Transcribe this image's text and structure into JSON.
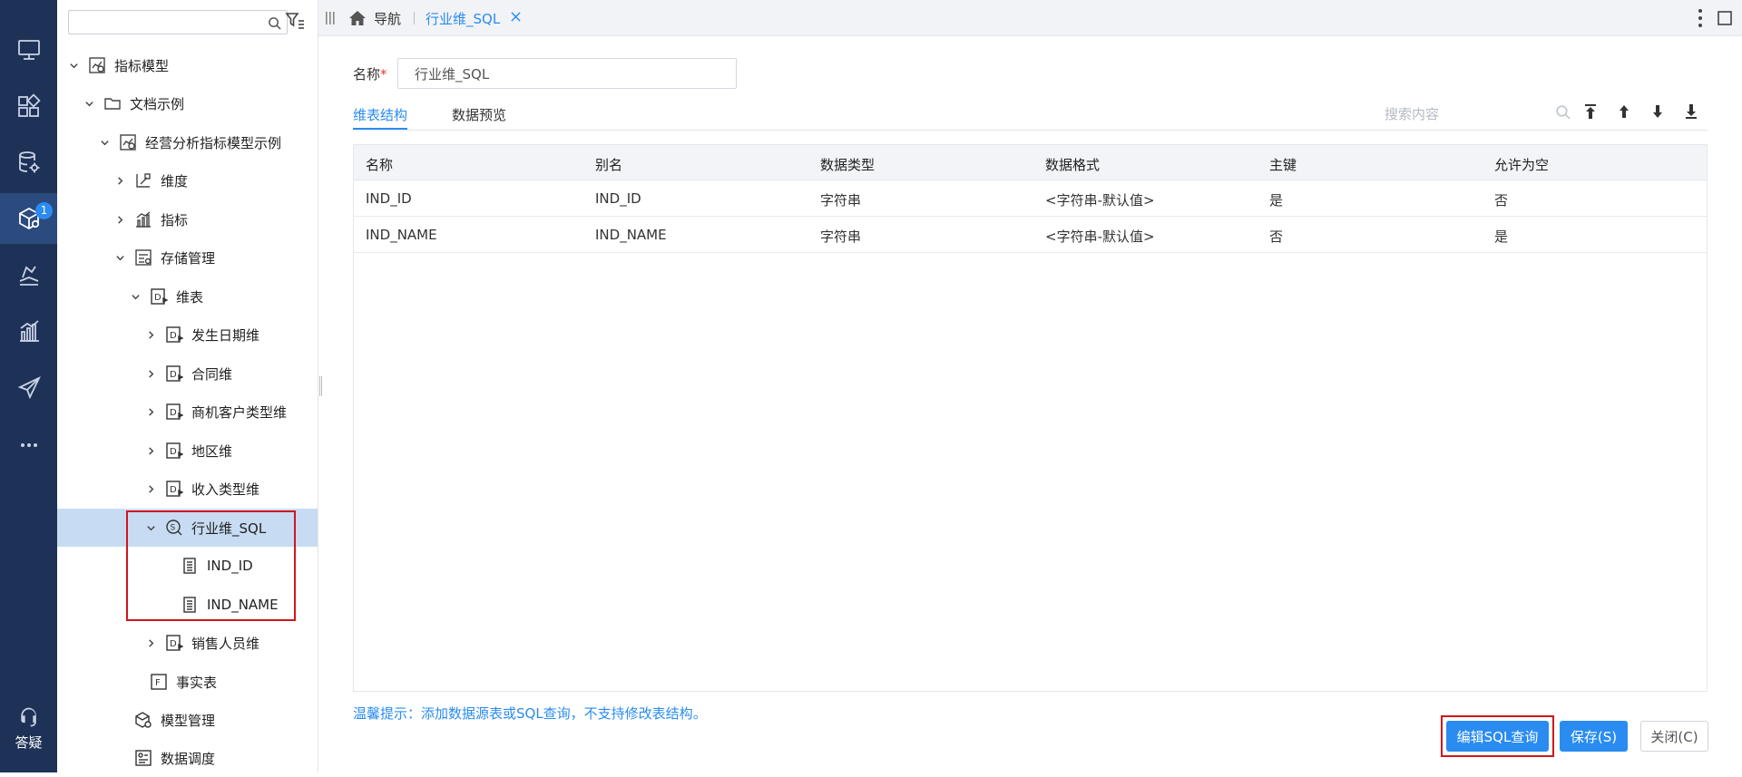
{
  "rail": {
    "badge": "1",
    "help_label": "答疑",
    "items": [
      {
        "icon": "monitor-icon"
      },
      {
        "icon": "apps-icon"
      },
      {
        "icon": "database-settings-icon"
      },
      {
        "icon": "cube-icon"
      },
      {
        "icon": "layers-icon"
      },
      {
        "icon": "bar-chart-icon"
      },
      {
        "icon": "send-icon"
      },
      {
        "icon": "more-horizontal-icon"
      }
    ]
  },
  "tree": {
    "search_placeholder": "",
    "nodes": [
      {
        "label": "指标模型",
        "icon": "metric-model-icon",
        "expanded": true
      },
      {
        "label": "文档示例",
        "icon": "folder-icon",
        "expanded": true
      },
      {
        "label": "经营分析指标模型示例",
        "icon": "metric-model-icon",
        "expanded": true
      },
      {
        "label": "维度",
        "icon": "dimension-icon",
        "expanded": false
      },
      {
        "label": "指标",
        "icon": "metric-icon",
        "expanded": false
      },
      {
        "label": "存储管理",
        "icon": "storage-icon",
        "expanded": true
      },
      {
        "label": "维表",
        "icon": "dim-table-icon",
        "expanded": true
      },
      {
        "label": "发生日期维",
        "icon": "dim-table-icon",
        "expanded": false
      },
      {
        "label": "合同维",
        "icon": "dim-table-icon",
        "expanded": false
      },
      {
        "label": "商机客户类型维",
        "icon": "dim-table-icon",
        "expanded": false
      },
      {
        "label": "地区维",
        "icon": "dim-table-icon",
        "expanded": false
      },
      {
        "label": "收入类型维",
        "icon": "dim-table-icon",
        "expanded": false
      },
      {
        "label": "行业维_SQL",
        "icon": "sql-query-icon",
        "expanded": true
      },
      {
        "label": "IND_ID",
        "icon": "field-icon"
      },
      {
        "label": "IND_NAME",
        "icon": "field-icon"
      },
      {
        "label": "销售人员维",
        "icon": "dim-table-icon",
        "expanded": false
      },
      {
        "label": "事实表",
        "icon": "fact-table-icon"
      },
      {
        "label": "模型管理",
        "icon": "model-manage-icon"
      },
      {
        "label": "数据调度",
        "icon": "schedule-icon"
      }
    ]
  },
  "tabs": {
    "home_label": "导航",
    "active_label": "行业维_SQL"
  },
  "form": {
    "name_label": "名称",
    "required_mark": "*",
    "name_value": "行业维_SQL"
  },
  "subtabs": [
    "维表结构",
    "数据预览"
  ],
  "search": {
    "placeholder": "搜索内容"
  },
  "table": {
    "columns": [
      "名称",
      "别名",
      "数据类型",
      "数据格式",
      "主键",
      "允许为空"
    ],
    "rows": [
      [
        "IND_ID",
        "IND_ID",
        "字符串",
        "<字符串-默认值>",
        "是",
        "否"
      ],
      [
        "IND_NAME",
        "IND_NAME",
        "字符串",
        "<字符串-默认值>",
        "否",
        "是"
      ]
    ]
  },
  "hint": "温馨提示：添加数据源表或SQL查询，不支持修改表结构。",
  "buttons": {
    "edit_sql": "编辑SQL查询",
    "save": "保存(S)",
    "close": "关闭(C)"
  },
  "colors": {
    "rail_bg": "#1e3257",
    "accent": "#2a8cf0",
    "selected_row": "#c7dcf2",
    "highlight_box": "#d0161b"
  }
}
